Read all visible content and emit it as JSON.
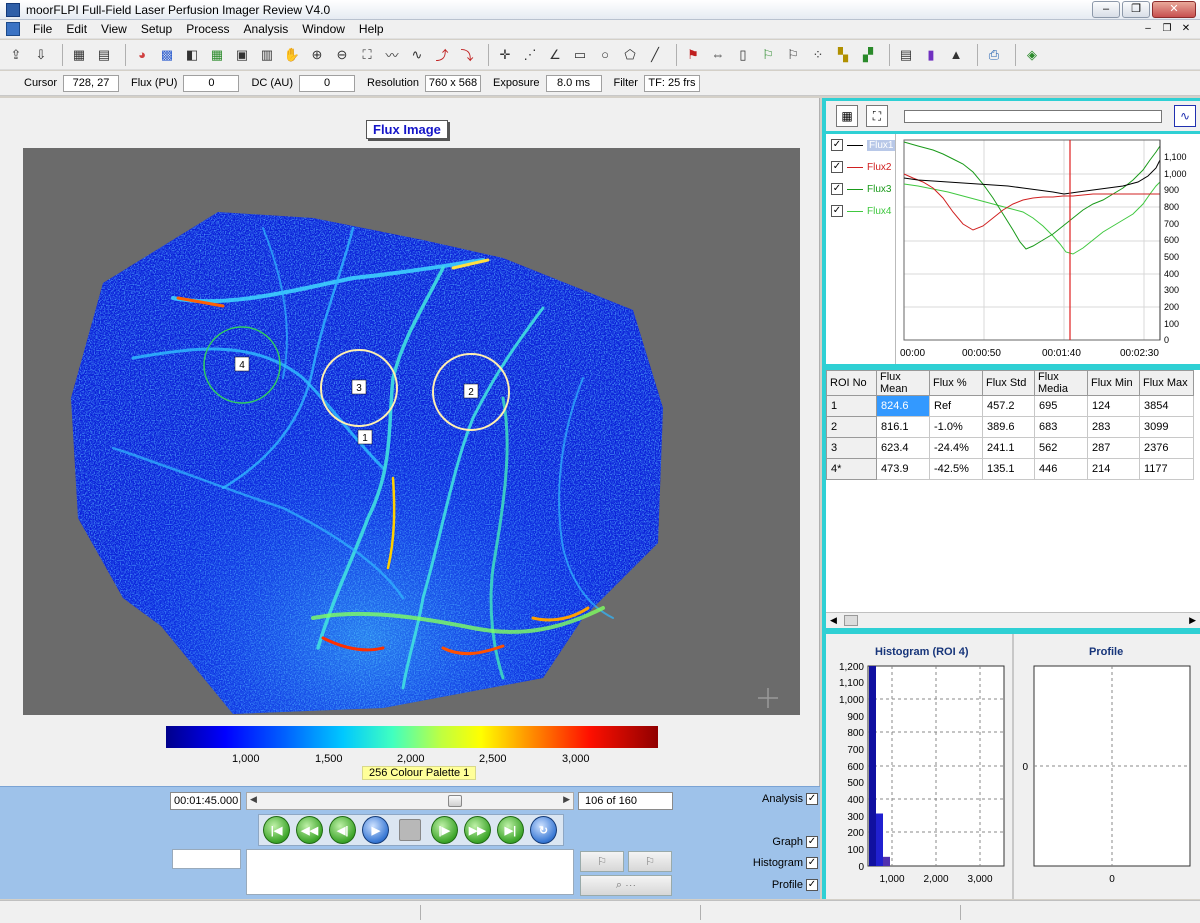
{
  "window": {
    "title": "moorFLPI Full-Field Laser Perfusion Imager Review V4.0"
  },
  "menu": [
    "File",
    "Edit",
    "View",
    "Setup",
    "Process",
    "Analysis",
    "Window",
    "Help"
  ],
  "status": {
    "cursor_label": "Cursor",
    "cursor_value": "728, 27",
    "flux_label": "Flux (PU)",
    "flux_value": "0",
    "dc_label": "DC (AU)",
    "dc_value": "0",
    "resolution_label": "Resolution",
    "resolution_value": "760 x 568",
    "exposure_label": "Exposure",
    "exposure_value": "8.0 ms",
    "filter_label": "Filter",
    "filter_value": "TF: 25 frs"
  },
  "image": {
    "title": "Flux Image",
    "rois": [
      {
        "label": "4"
      },
      {
        "label": "3"
      },
      {
        "label": "2"
      },
      {
        "label": "1"
      }
    ],
    "colorbar_ticks": [
      "1,000",
      "1,500",
      "2,000",
      "2,500",
      "3,000"
    ],
    "palette": "256 Colour Palette 1"
  },
  "playback": {
    "time": "00:01:45.000",
    "frame": "106 of 160",
    "progress": 0.66,
    "checks": {
      "analysis": "Analysis",
      "graph": "Graph",
      "histogram": "Histogram",
      "profile": "Profile"
    }
  },
  "graph": {
    "legend": [
      "Flux1",
      "Flux2",
      "Flux3",
      "Flux4"
    ],
    "colors": [
      "#000000",
      "#d02020",
      "#1a9a1a",
      "#40c840"
    ],
    "y_ticks": [
      "0",
      "100",
      "200",
      "300",
      "400",
      "500",
      "600",
      "700",
      "800",
      "900",
      "1,000",
      "1,100"
    ],
    "x_ticks": [
      "00:00",
      "00:00:50",
      "00:01:40",
      "00:02:30"
    ],
    "cursor_color": "#e02020"
  },
  "table": {
    "headers": [
      "ROI No",
      "Flux Mean",
      "Flux %",
      "Flux Std",
      "Flux Media",
      "Flux Min",
      "Flux Max"
    ],
    "rows": [
      [
        "1",
        "824.6",
        "Ref",
        "457.2",
        "695",
        "124",
        "3854"
      ],
      [
        "2",
        "816.1",
        "-1.0%",
        "389.6",
        "683",
        "283",
        "3099"
      ],
      [
        "3",
        "623.4",
        "-24.4%",
        "241.1",
        "562",
        "287",
        "2376"
      ],
      [
        "4*",
        "473.9",
        "-42.5%",
        "135.1",
        "446",
        "214",
        "1177"
      ]
    ]
  },
  "histogram": {
    "title": "Histogram (ROI 4)",
    "y_ticks": [
      "0",
      "100",
      "200",
      "300",
      "400",
      "500",
      "600",
      "700",
      "800",
      "900",
      "1,000",
      "1,100",
      "1,200"
    ],
    "x_ticks": [
      "1,000",
      "2,000",
      "3,000"
    ],
    "bars": [
      1200,
      315,
      55
    ]
  },
  "profile": {
    "title": "Profile",
    "y_tick": "0",
    "x_tick": "0"
  }
}
